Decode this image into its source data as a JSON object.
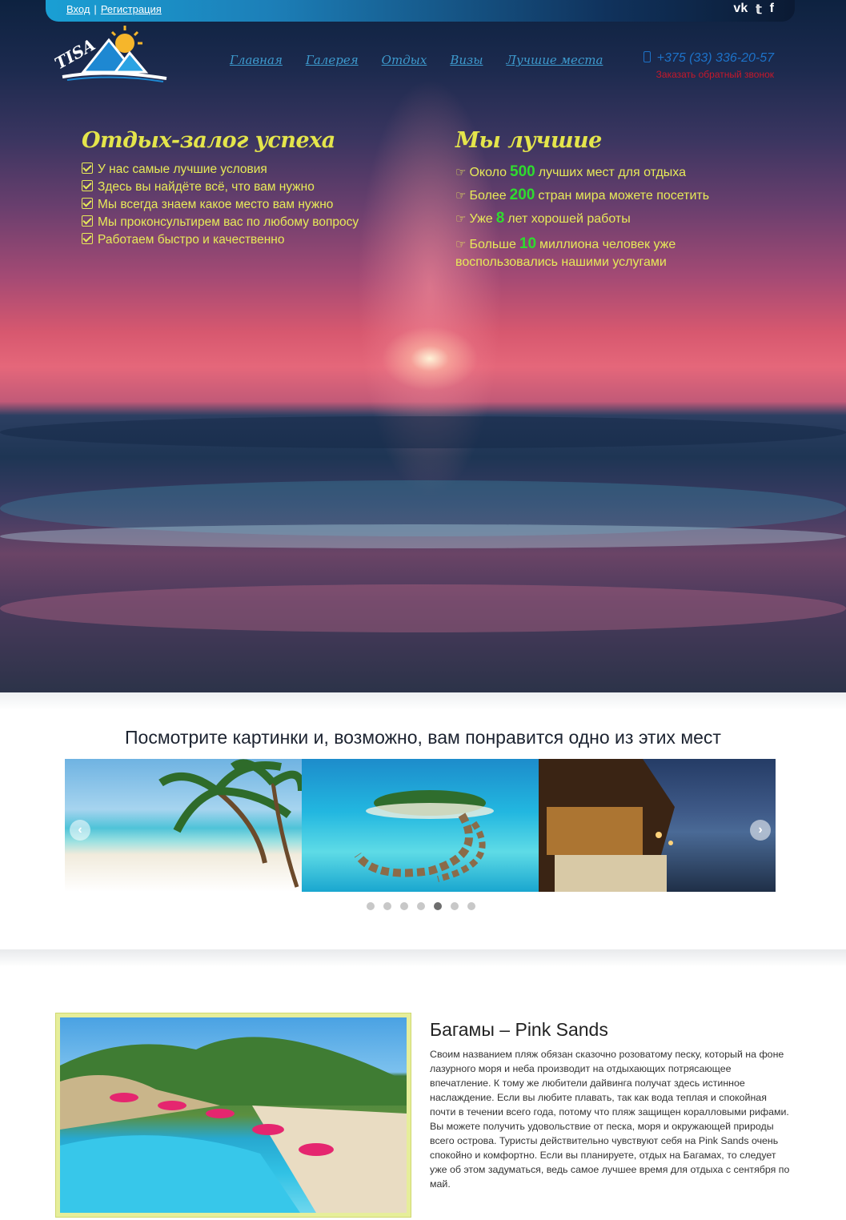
{
  "header": {
    "login": "Вход",
    "register": "Регистрация",
    "separator": "|",
    "social": [
      "vk-icon",
      "twitter-icon",
      "facebook-icon"
    ],
    "social_glyphs": [
      "vk",
      "𝕥",
      "f"
    ],
    "logo_text": "TISA",
    "nav": [
      "Главная",
      "Галерея",
      "Отдых",
      "Визы",
      "Лучшие места"
    ],
    "phone": "+375 (33) 336-20-57",
    "callback": "Заказать обратный звонок"
  },
  "hero": {
    "left": {
      "title": "Отдых-залог успеха",
      "items": [
        "У нас самые лучшие условия",
        "Здесь вы найдёте всё, что вам нужно",
        "Мы всегда знаем какое место вам нужно",
        "Мы проконсультирем вас по любому вопросу",
        "Работаем быстро и качественно"
      ]
    },
    "right": {
      "title": "Мы лучшие",
      "items": [
        {
          "before": "Около",
          "num": "500",
          "after": "лучших мест для отдыха"
        },
        {
          "before": "Более",
          "num": "200",
          "after": "стран мира можете посетить"
        },
        {
          "before": "Уже",
          "num": "8",
          "after": "лет хорошей работы"
        },
        {
          "before": "Больше",
          "num": "10",
          "after": "миллиона человек уже воспользовались нашими услугами"
        }
      ]
    }
  },
  "gallery": {
    "title": "Посмотрите картинки и, возможно, вам понравится одно из этих мест",
    "prev": "‹",
    "next": "›",
    "dots_total": 7,
    "active_dot": 5
  },
  "article": {
    "title": "Багамы – Pink Sands",
    "text": "Своим названием пляж обязан сказочно розоватому песку, который на фоне лазурного моря и неба производит на отдыхающих потрясающее впечатление. К тому же любители дайвинга получат здесь истинное наслаждение. Если вы любите плавать, так как вода теплая и спокойная почти в течении всего года, потому что пляж защищен коралловыми рифами. Вы можете получить удовольствие от песка, моря и окружающей природы всего острова. Туристы действительно чувствуют себя на Pink Sands очень спокойно и комфортно. Если вы планируете, отдых на Багамах, то следует уже об этом задуматься, ведь самое лучшее время для отдыха с сентября по май."
  }
}
